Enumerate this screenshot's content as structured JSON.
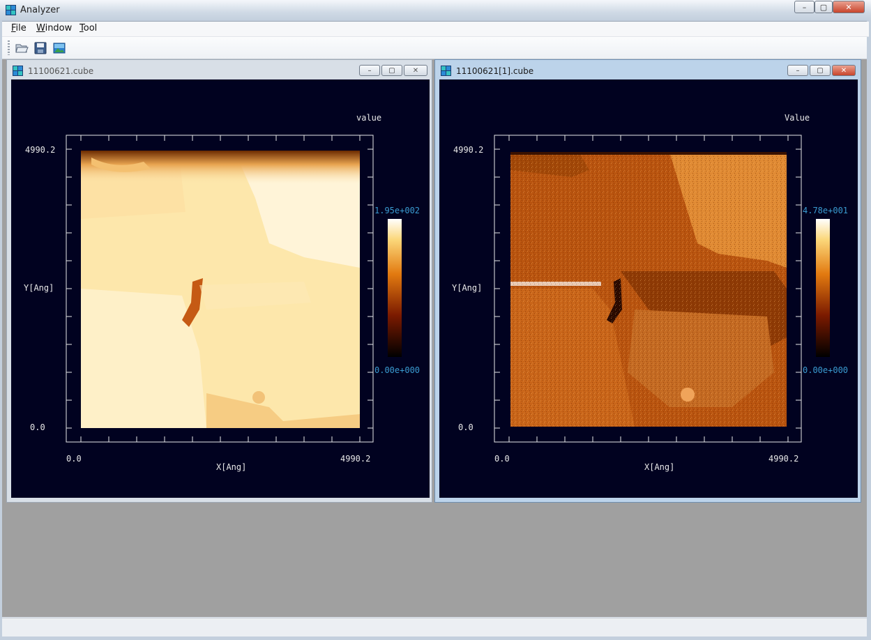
{
  "app": {
    "title": "Analyzer",
    "window_buttons": {
      "minimize": "–",
      "maximize": "▢",
      "close": "✕"
    }
  },
  "menu": [
    {
      "first": "F",
      "rest": "ile"
    },
    {
      "first": "W",
      "rest": "indow"
    },
    {
      "first": "T",
      "rest": "ool"
    }
  ],
  "toolbar": {
    "icons": [
      "open-folder-icon",
      "save-disk-icon",
      "image-view-icon"
    ]
  },
  "colors": {
    "plot_bg": "#010220",
    "axis": "#e8e8e8",
    "scale_label": "#3a9bd0"
  },
  "windows": [
    {
      "title": "11100621.cube",
      "active": false,
      "plot": {
        "value_label": "value",
        "y_label": "Y[Ang]",
        "x_label": "X[Ang]",
        "x_min": "0.0",
        "x_max": "4990.2",
        "y_min": "0.0",
        "y_max": "4990.2",
        "scale_max": "1.95e+002",
        "scale_min": "0.00e+000",
        "image_style": "bright"
      }
    },
    {
      "title": "11100621[1].cube",
      "active": true,
      "plot": {
        "value_label": "Value",
        "y_label": "Y[Ang]",
        "x_label": "X[Ang]",
        "x_min": "0.0",
        "x_max": "4990.2",
        "y_min": "0.0",
        "y_max": "4990.2",
        "scale_max": "4.78e+001",
        "scale_min": "0.00e+000",
        "image_style": "dark"
      }
    }
  ]
}
